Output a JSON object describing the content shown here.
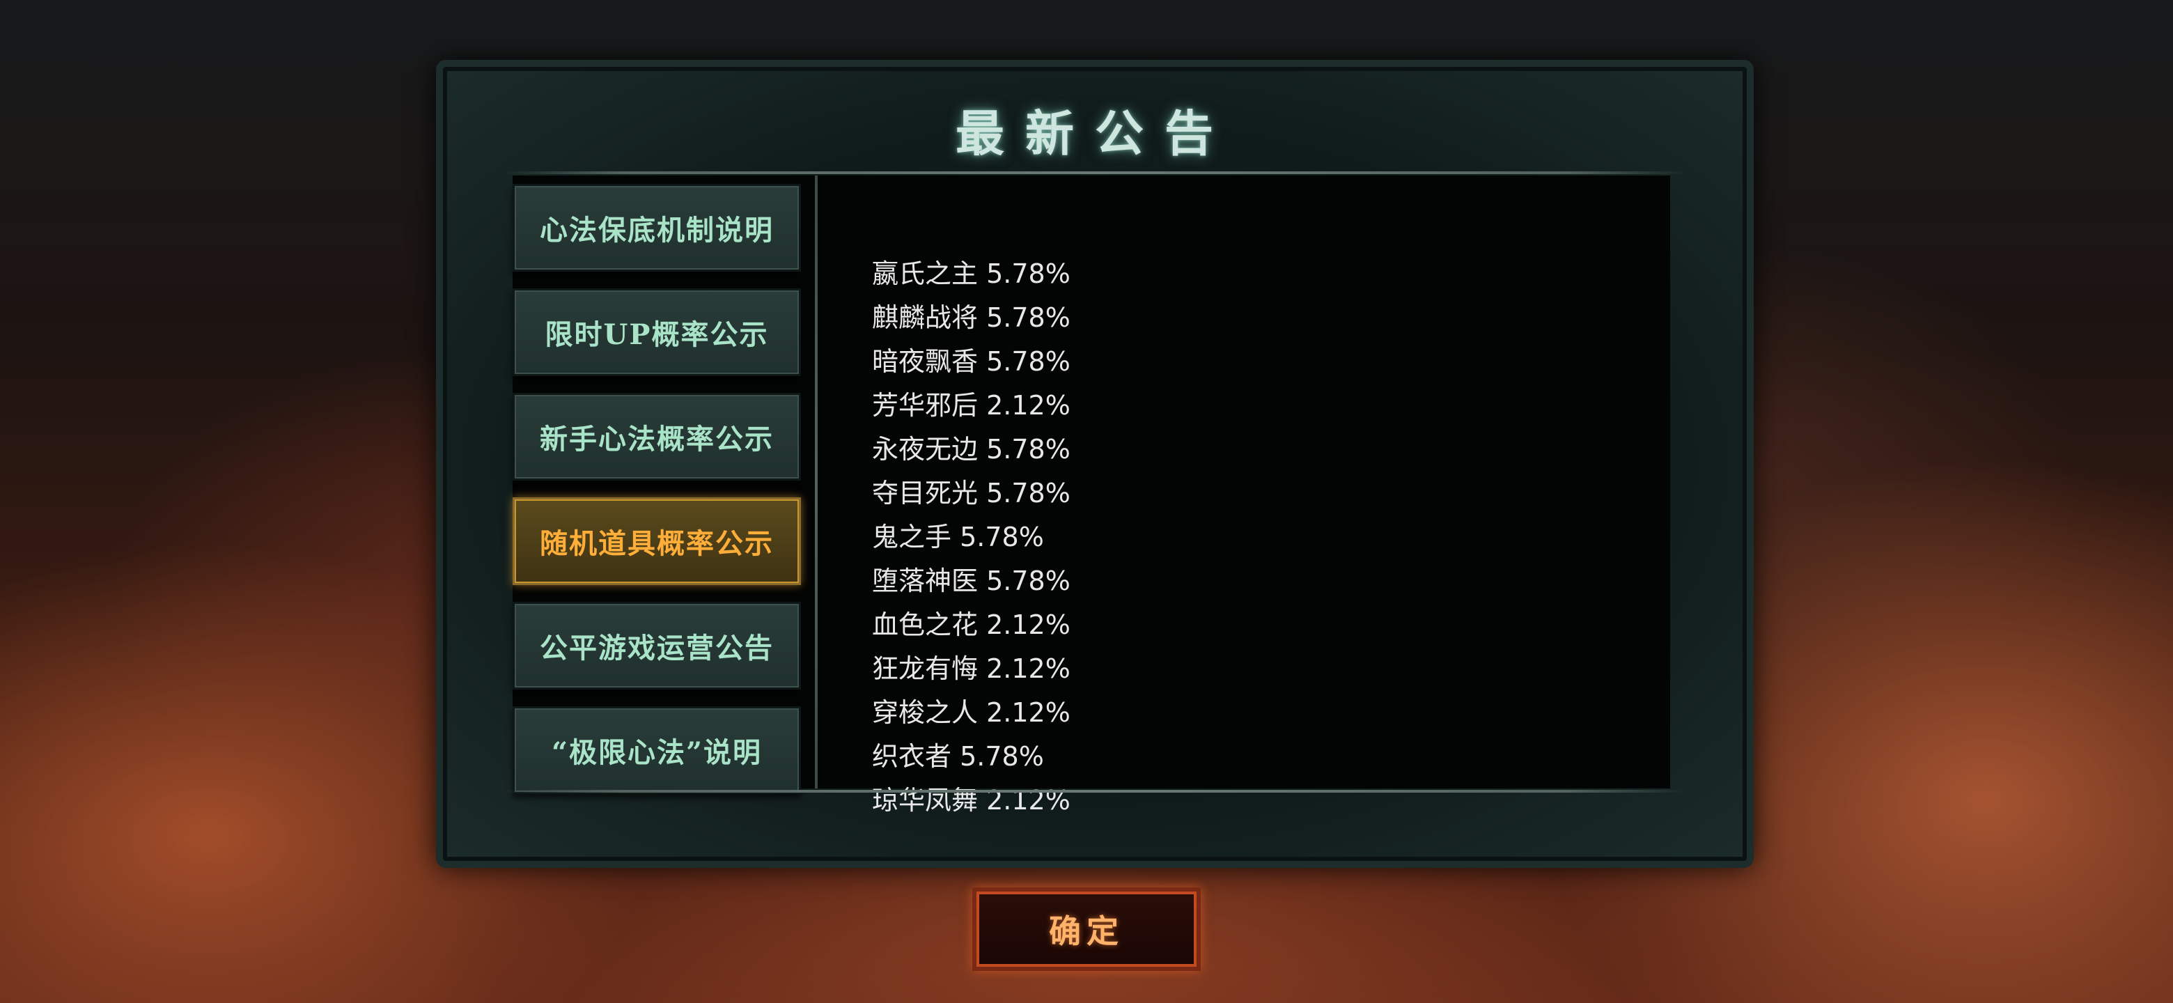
{
  "background_hint": "",
  "dialog": {
    "title": "最新公告",
    "tabs": [
      {
        "label": "心法保底机制说明"
      },
      {
        "label": "限时UP概率公示"
      },
      {
        "label": "新手心法概率公示"
      },
      {
        "label": "随机道具概率公示",
        "active": true
      },
      {
        "label": "公平游戏运营公告"
      },
      {
        "label": "“极限心法”说明"
      }
    ],
    "items": [
      "嬴氏之主 5.78%",
      "麒麟战将 5.78%",
      "暗夜飘香 5.78%",
      "芳华邪后 2.12%",
      "永夜无边 5.78%",
      "夺目死光 5.78%",
      "鬼之手 5.78%",
      "堕落神医 5.78%",
      "血色之花 2.12%",
      "狂龙有悔 2.12%",
      "穿梭之人 2.12%",
      "织衣者 5.78%",
      "琼华凤舞 2.12%"
    ],
    "confirm_label": "确定"
  },
  "colors": {
    "tab_text": "#a9e3c8",
    "tab_active_text": "#ffae3a",
    "title_text": "#cfe6de",
    "confirm_text": "#ffb36a"
  }
}
